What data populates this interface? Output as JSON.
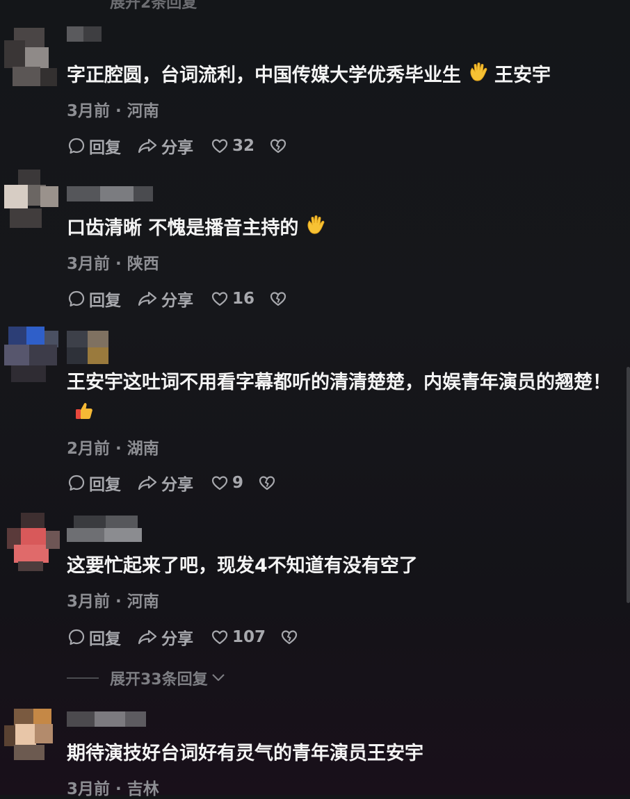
{
  "top_expand_label": "展开2条回复",
  "comments": [
    {
      "text": "字正腔圆，台词流利，中国传媒大学优秀毕业生",
      "text_after_emoji": "王安宇",
      "emoji": "clap-hands-emoji",
      "time": "3月前",
      "location": "河南",
      "reply_label": "回复",
      "share_label": "分享",
      "likes": "32"
    },
    {
      "text": "口齿清晰 不愧是播音主持的",
      "emoji": "clap-hands-emoji",
      "time": "3月前",
      "location": "陕西",
      "reply_label": "回复",
      "share_label": "分享",
      "likes": "16"
    },
    {
      "text": "王安宇这吐词不用看字幕都听的清清楚楚，内娱青年演员的翘楚！",
      "emoji": "thumbs-up-emoji",
      "time": "2月前",
      "location": "湖南",
      "reply_label": "回复",
      "share_label": "分享",
      "likes": "9"
    },
    {
      "text": "这要忙起来了吧，现发4不知道有没有空了",
      "time": "3月前",
      "location": "河南",
      "reply_label": "回复",
      "share_label": "分享",
      "likes": "107",
      "expand_label": "展开33条回复"
    },
    {
      "text": "期待演技好台词好有灵气的青年演员王安宇",
      "time": "3月前",
      "location": "吉林"
    }
  ],
  "meta_separator": "·",
  "icons": {
    "reply": "comment-bubble-icon",
    "share": "share-arrow-icon",
    "like": "heart-icon",
    "dislike": "broken-heart-icon",
    "expand": "chevron-down-icon"
  },
  "colors": {
    "background": "#15161a",
    "comment_text": "#f4f4f4",
    "meta_text": "#8d8e93",
    "action_text": "#a7a8ad"
  }
}
